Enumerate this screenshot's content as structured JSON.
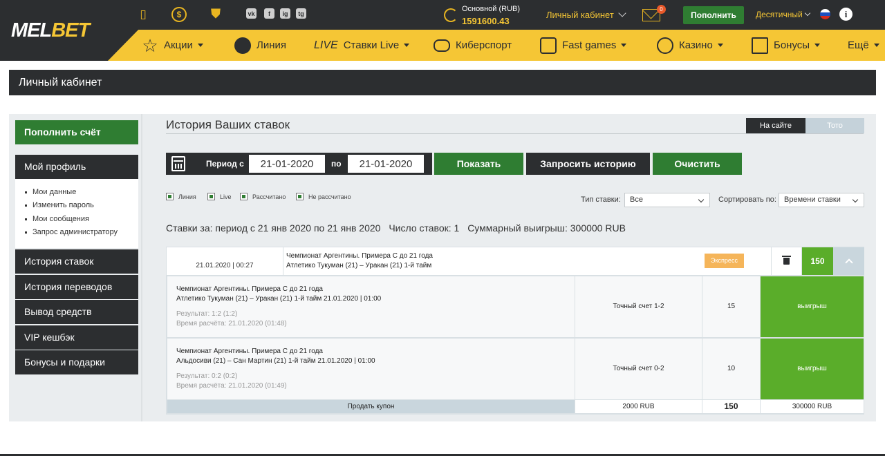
{
  "header": {
    "logo": {
      "part1": "MEL",
      "part2": "BET"
    },
    "balance_label": "Основной (RUB)",
    "balance_value": "1591600.43",
    "cabinet_link": "Личный кабинет",
    "mail_badge": "0",
    "deposit_button": "Пополнить",
    "odds_format": "Десятичный",
    "info_glyph": "i",
    "social": [
      "vk",
      "f",
      "ig",
      "tg"
    ],
    "colors": {
      "dark": "#2c2e30",
      "yellow": "#f5c635",
      "green": "#2f7d32",
      "win": "#5aad2a"
    }
  },
  "nav": {
    "items": [
      {
        "label": "Акции",
        "icon": "star-icon",
        "dropdown": true
      },
      {
        "label": "Линия",
        "icon": "football-icon",
        "dropdown": false
      },
      {
        "prefix": "LIVE",
        "label": "Ставки Live",
        "dropdown": true
      },
      {
        "label": "Киберспорт",
        "icon": "gamepad-icon",
        "dropdown": false
      },
      {
        "label": "Fast games",
        "icon": "dice-icon",
        "dropdown": true
      },
      {
        "label": "Казино",
        "icon": "chip-icon",
        "dropdown": true
      },
      {
        "label": "Бонусы",
        "icon": "gift-icon",
        "dropdown": true
      },
      {
        "label": "Ещё",
        "dropdown": true
      }
    ]
  },
  "page": {
    "title": "Личный кабинет"
  },
  "sidebar": {
    "deposit": "Пополнить счёт",
    "profile": "Мой профиль",
    "sub_items": [
      "Мои данные",
      "Изменить пароль",
      "Мои сообщения",
      "Запрос администратору"
    ],
    "items": [
      "История ставок",
      "История переводов",
      "Вывод средств",
      "VIP кешбэк",
      "Бонусы и подарки"
    ]
  },
  "main": {
    "title": "История Ваших ставок",
    "tabs": [
      "На сайте",
      "Тото"
    ],
    "period_from_label": "Период с",
    "date_from": "21-01-2020",
    "period_to_label": "по",
    "date_to": "21-01-2020",
    "buttons": {
      "show": "Показать",
      "request": "Запросить историю",
      "clear": "Очистить"
    },
    "filters": [
      "Линия",
      "Live",
      "Рассчитано",
      "Не рассчитано"
    ],
    "bet_type_label": "Тип ставки:",
    "bet_type_value": "Все",
    "sort_label": "Сортировать по:",
    "sort_value": "Времени ставки",
    "summary": {
      "period": "Ставки за: период с 21 янв 2020 по 21 янв 2020",
      "count": "Число ставок: 1",
      "total": "Суммарный выигрыш: 300000 RUB"
    }
  },
  "coupon": {
    "datetime": "21.01.2020 | 00:27",
    "league": "Чемпионат Аргентины. Примера С до 21 года",
    "match": "Атлетико Тукуман (21) – Уракан (21) 1-й тайм",
    "type_badge": "Экспресс",
    "coefficient": "150",
    "events": [
      {
        "league": "Чемпионат Аргентины. Примера С до 21 года",
        "match": "Атлетико Тукуман (21) – Уракан (21) 1-й тайм 21.01.2020 | 01:00",
        "result": "Результат: 1:2 (1:2)",
        "calc_time": "Время расчёта: 21.01.2020 (01:48)",
        "bet": "Точный счет 1-2",
        "coef": "15",
        "status": "выигрыш"
      },
      {
        "league": "Чемпионат Аргентины. Примера С до 21 года",
        "match": "Альдосиви (21) – Сан Мартин (21) 1-й тайм 21.01.2020 | 01:00",
        "result": "Результат: 0:2 (0:2)",
        "calc_time": "Время расчёта: 21.01.2020 (01:49)",
        "bet": "Точный счет 0-2",
        "coef": "10",
        "status": "выигрыш"
      }
    ],
    "footer": {
      "sell": "Продать купон",
      "stake": "2000 RUB",
      "total_coef": "150",
      "payout": "300000 RUB"
    }
  }
}
